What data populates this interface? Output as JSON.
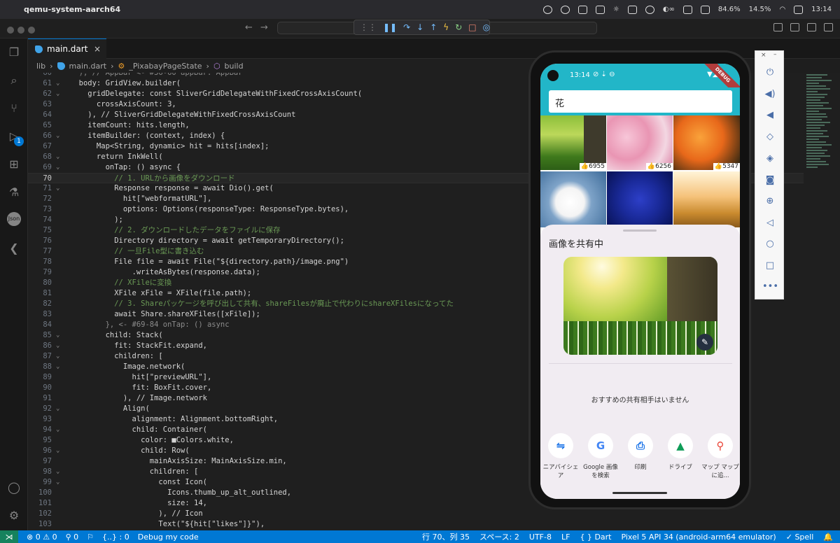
{
  "menubar": {
    "app_name": "qemu-system-aarch64",
    "battery1": "84.6%",
    "battery2": "14.5%",
    "time": "13:14"
  },
  "tab": {
    "filename": "main.dart"
  },
  "breadcrumb": {
    "lib": "lib",
    "file": "main.dart",
    "state": "_PixabayPageState",
    "method": "build"
  },
  "activity": {
    "debug_badge": "1",
    "json_label": "Json"
  },
  "code_lines": [
    {
      "n": "60",
      "text": "  ), // AppBar <- #36-60 appBar: AppBar"
    },
    {
      "n": "61",
      "text": "  body: GridView.builder("
    },
    {
      "n": "62",
      "text": "    gridDelegate: const SliverGridDelegateWithFixedCrossAxisCount("
    },
    {
      "n": "63",
      "text": "      crossAxisCount: 3,"
    },
    {
      "n": "64",
      "text": "    ), // SliverGridDelegateWithFixedCrossAxisCount"
    },
    {
      "n": "65",
      "text": "    itemCount: hits.length,"
    },
    {
      "n": "66",
      "text": "    itemBuilder: (context, index) {"
    },
    {
      "n": "67",
      "text": "      Map<String, dynamic> hit = hits[index];"
    },
    {
      "n": "68",
      "text": "      return InkWell("
    },
    {
      "n": "69",
      "text": "        onTap: () async {"
    },
    {
      "n": "70",
      "text": "          // 1. URLから画像をダウンロード"
    },
    {
      "n": "71",
      "text": "          Response response = await Dio().get("
    },
    {
      "n": "72",
      "text": "            hit[\"webformatURL\"],"
    },
    {
      "n": "73",
      "text": "            options: Options(responseType: ResponseType.bytes),"
    },
    {
      "n": "74",
      "text": "          );"
    },
    {
      "n": "75",
      "text": "          // 2. ダウンロードしたデータをファイルに保存"
    },
    {
      "n": "76",
      "text": "          Directory directory = await getTemporaryDirectory();"
    },
    {
      "n": "77",
      "text": "          // 一旦File型に書き込む"
    },
    {
      "n": "78",
      "text": "          File file = await File(\"${directory.path}/image.png\")"
    },
    {
      "n": "79",
      "text": "              .writeAsBytes(response.data);"
    },
    {
      "n": "80",
      "text": "          // XFileに変換"
    },
    {
      "n": "81",
      "text": "          XFile xFile = XFile(file.path);"
    },
    {
      "n": "82",
      "text": "          // 3. Shareパッケージを呼び出して共有、shareFilesが廃止で代わりにshareXFilesになってた"
    },
    {
      "n": "83",
      "text": "          await Share.shareXFiles([xFile]);"
    },
    {
      "n": "84",
      "text": "        }, <- #69-84 onTap: () async"
    },
    {
      "n": "85",
      "text": "        child: Stack("
    },
    {
      "n": "86",
      "text": "          fit: StackFit.expand,"
    },
    {
      "n": "87",
      "text": "          children: ["
    },
    {
      "n": "88",
      "text": "            Image.network("
    },
    {
      "n": "89",
      "text": "              hit[\"previewURL\"],"
    },
    {
      "n": "90",
      "text": "              fit: BoxFit.cover,"
    },
    {
      "n": "91",
      "text": "            ), // Image.network"
    },
    {
      "n": "92",
      "text": "            Align("
    },
    {
      "n": "93",
      "text": "              alignment: Alignment.bottomRight,"
    },
    {
      "n": "94",
      "text": "              child: Container("
    },
    {
      "n": "95",
      "text": "                color: ■Colors.white,"
    },
    {
      "n": "96",
      "text": "                child: Row("
    },
    {
      "n": "97",
      "text": "                  mainAxisSize: MainAxisSize.min,"
    },
    {
      "n": "98",
      "text": "                  children: ["
    },
    {
      "n": "99",
      "text": "                    const Icon("
    },
    {
      "n": "100",
      "text": "                      Icons.thumb_up_alt_outlined,"
    },
    {
      "n": "101",
      "text": "                      size: 14,"
    },
    {
      "n": "102",
      "text": "                    ), // Icon"
    },
    {
      "n": "103",
      "text": "                    Text(\"${hit[\"likes\"]}\"),"
    }
  ],
  "current_line": "70",
  "phone": {
    "time": "13:14",
    "debug_ribbon": "DEBUG",
    "search_value": "花",
    "likes": [
      "6955",
      "6256",
      "5347"
    ],
    "sheet_title": "画像を共有中",
    "no_share": "おすすめの共有相手はいません",
    "targets": [
      {
        "label": "ニアバイシェア",
        "icon": "nearby-share-icon"
      },
      {
        "label": "Google 画像を検索",
        "icon": "google-icon"
      },
      {
        "label": "印刷",
        "icon": "print-icon"
      },
      {
        "label": "ドライブ",
        "icon": "drive-icon"
      },
      {
        "label": "マップ マップに追...",
        "icon": "maps-icon"
      }
    ]
  },
  "status": {
    "errors": "0",
    "warnings": "0",
    "ports": "0",
    "braces": "{..} : 0",
    "debug": "Debug my code",
    "position": "行 70、列 35",
    "spaces": "スペース: 2",
    "encoding": "UTF-8",
    "eol": "LF",
    "language": "Dart",
    "device": "Pixel 5 API 34 (android-arm64 emulator)",
    "spell": "Spell"
  }
}
